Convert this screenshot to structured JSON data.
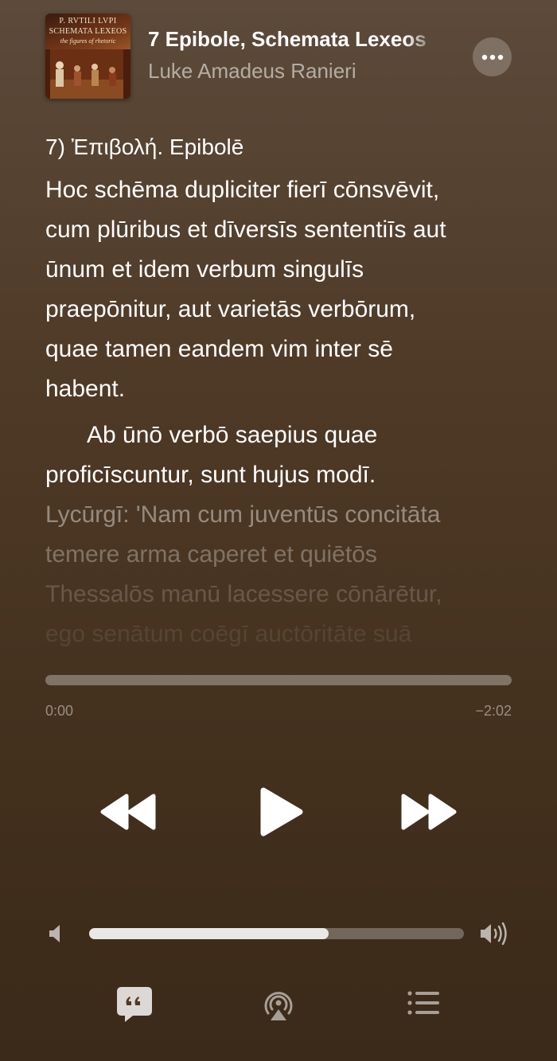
{
  "now_playing": {
    "title": "7 Epibole, Schemata Lexeos",
    "artist": "Luke Amadeus Ranieri",
    "artwork": {
      "line1": "P. RVTILI LVPI",
      "line2": "SCHEMATA LEXEOS",
      "line3": "the figures of rhetoric"
    }
  },
  "lyrics": {
    "heading": "7)  Ἐπιβολή. Epibolē",
    "paragraph1": [
      "Hoc schēma dupliciter fierī cōnsvēvit,",
      "cum plūribus et dīversīs sententiīs aut",
      "ūnum et idem verbum singulīs",
      "praepōnitur, aut varietās verbōrum,",
      "quae tamen eandem vim inter sē",
      "habent."
    ],
    "paragraph2": [
      "Ab ūnō verbō saepius quae",
      "proficīscuntur, sunt hujus modī.",
      "Lycūrgī: 'Nam cum juventūs concitāta",
      "temere arma caperet et quiētōs",
      "Thessalōs manū lacessere cōnārētur,",
      "ego senātum coēgī auctōritāte suā"
    ]
  },
  "playback": {
    "elapsed": "0:00",
    "remaining": "−2:02",
    "progress_fraction": 0.0,
    "volume_fraction": 0.64
  },
  "colors": {
    "background_top": "#5c4a3a",
    "background_bottom": "#3b2a19",
    "text_primary": "#ffffff"
  },
  "icons": {
    "more": "ellipsis-icon",
    "rewind": "rewind-icon",
    "play": "play-icon",
    "forward": "fast-forward-icon",
    "volume_low": "speaker-low-icon",
    "volume_high": "speaker-high-icon",
    "lyrics": "lyrics-quote-icon",
    "airplay": "airplay-audio-icon",
    "queue": "queue-list-icon"
  }
}
